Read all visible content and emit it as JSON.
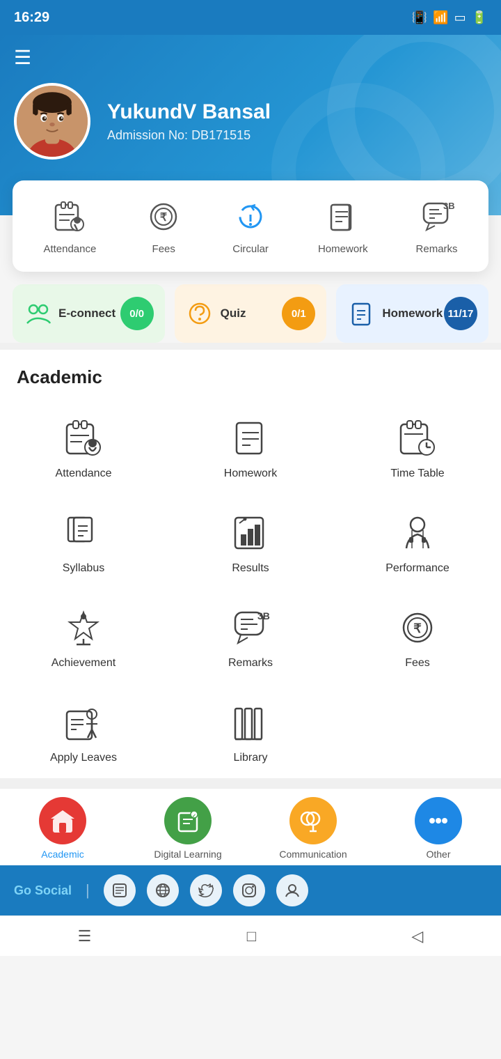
{
  "statusBar": {
    "time": "16:29",
    "icons": [
      "📳",
      "📶",
      "🔋"
    ]
  },
  "header": {
    "menuIcon": "☰",
    "profile": {
      "name": "YukundV Bansal",
      "admissionLabel": "Admission No:",
      "admissionNo": "DB171515"
    }
  },
  "quickMenu": {
    "items": [
      {
        "id": "attendance",
        "label": "Attendance"
      },
      {
        "id": "fees",
        "label": "Fees"
      },
      {
        "id": "circular",
        "label": "Circular"
      },
      {
        "id": "homework",
        "label": "Homework"
      },
      {
        "id": "remarks",
        "label": "Remarks"
      }
    ]
  },
  "stats": [
    {
      "id": "econnect",
      "label": "E-connect",
      "value": "0/0",
      "style": "green"
    },
    {
      "id": "quiz",
      "label": "Quiz",
      "value": "0/1",
      "style": "orange"
    },
    {
      "id": "homework",
      "label": "Homework",
      "value": "11/17",
      "style": "blue"
    }
  ],
  "academic": {
    "sectionTitle": "Academic",
    "items": [
      {
        "id": "attendance",
        "label": "Attendance"
      },
      {
        "id": "homework",
        "label": "Homework"
      },
      {
        "id": "timetable",
        "label": "Time Table"
      },
      {
        "id": "syllabus",
        "label": "Syllabus"
      },
      {
        "id": "results",
        "label": "Results"
      },
      {
        "id": "performance",
        "label": "Performance"
      },
      {
        "id": "achievement",
        "label": "Achievement"
      },
      {
        "id": "remarks",
        "label": "Remarks"
      },
      {
        "id": "fees",
        "label": "Fees"
      },
      {
        "id": "applyleaves",
        "label": "Apply Leaves"
      },
      {
        "id": "library",
        "label": "Library"
      }
    ]
  },
  "bottomNav": {
    "items": [
      {
        "id": "academic",
        "label": "Academic",
        "active": true,
        "color": "#e53935"
      },
      {
        "id": "digital",
        "label": "Digital Learning",
        "active": false,
        "color": "#43a047"
      },
      {
        "id": "communication",
        "label": "Communication",
        "active": false,
        "color": "#f9a825"
      },
      {
        "id": "other",
        "label": "Other",
        "active": false,
        "color": "#1e88e5"
      }
    ]
  },
  "goSocial": {
    "label": "Go Social",
    "socialIcons": [
      "📰",
      "🌐",
      "🐦",
      "📷",
      "👤"
    ]
  },
  "androidNav": {
    "buttons": [
      "☰",
      "□",
      "◁"
    ]
  }
}
